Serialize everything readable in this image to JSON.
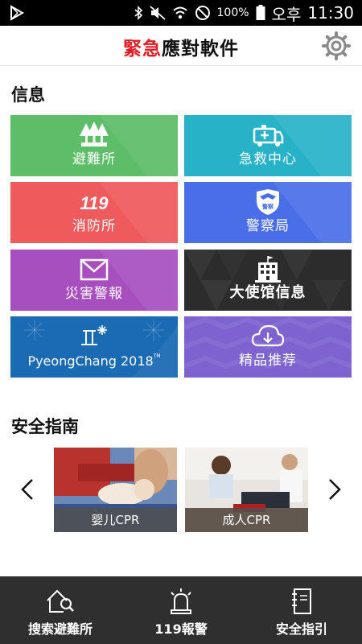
{
  "status_bar": {
    "battery_percent": "100%",
    "ampm": "오후",
    "time": "11:30"
  },
  "header": {
    "title_red": "緊急",
    "title_dark": "應對軟件"
  },
  "sections": {
    "info_title": "信息",
    "guide_title": "安全指南"
  },
  "tiles": [
    {
      "label": "避難所",
      "color": "#5dbd69"
    },
    {
      "label": "急救中心",
      "color": "#28b2c8"
    },
    {
      "label": "消防所",
      "color": "#ef5a5c",
      "icon_text": "119"
    },
    {
      "label": "警察局",
      "color": "#4a6ee8",
      "icon_text": "警察"
    },
    {
      "label": "災害警報",
      "color": "#a84fc0"
    },
    {
      "label": "大使馆信息",
      "color": "#2c2c2c"
    },
    {
      "label": "PyeongChang 2018",
      "tm": "TM",
      "color": "#1b6ab4"
    },
    {
      "label": "精品推荐",
      "color": "#7d62d0"
    }
  ],
  "guides": [
    {
      "label": "婴儿CPR"
    },
    {
      "label": "成人CPR"
    }
  ],
  "bottom_nav": [
    {
      "label": "搜索避難所",
      "icon": "house-search-icon"
    },
    {
      "label": "119報警",
      "icon": "siren-icon"
    },
    {
      "label": "安全指引",
      "icon": "notebook-icon"
    }
  ]
}
